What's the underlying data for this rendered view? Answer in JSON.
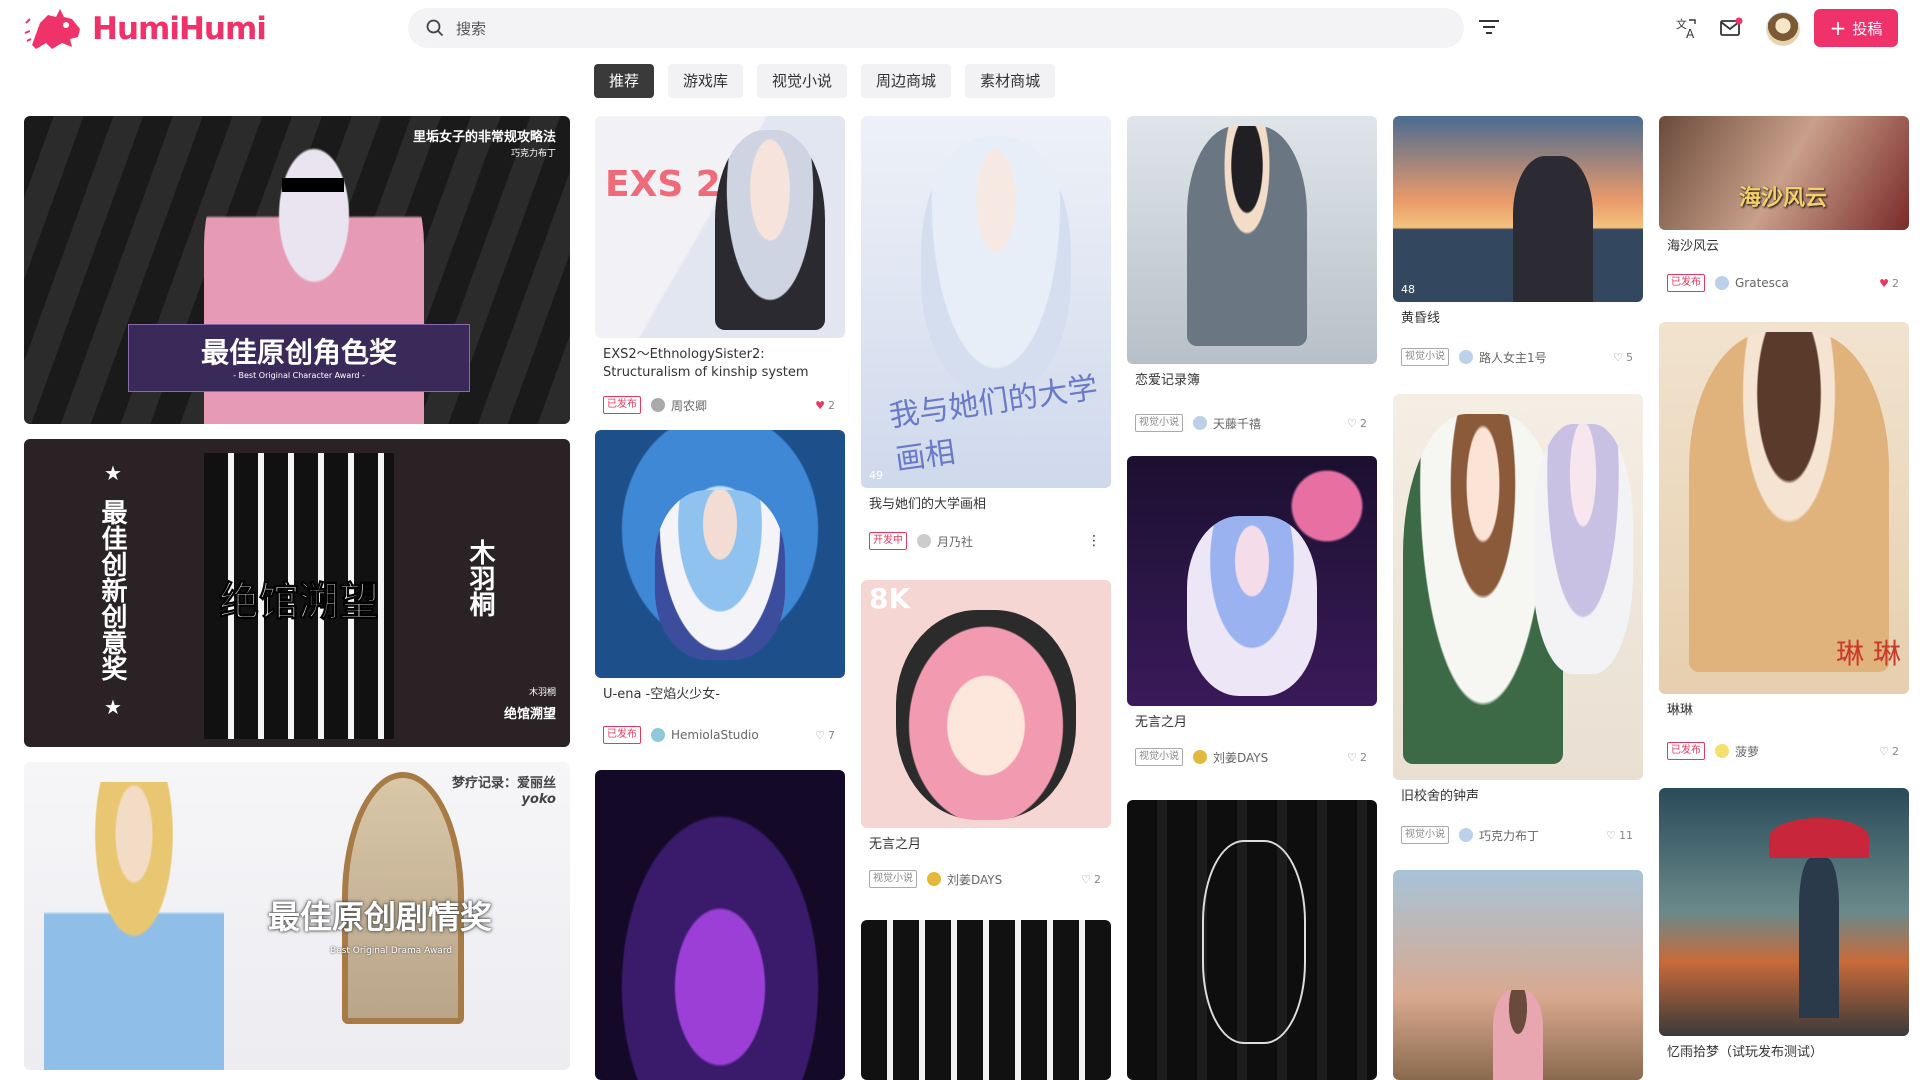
{
  "brand": {
    "name": "HumiHumi",
    "color": "#f0326a"
  },
  "search": {
    "placeholder": "搜索"
  },
  "header": {
    "post_label": "投稿"
  },
  "tabs": [
    "推荐",
    "游戏库",
    "视觉小说",
    "周边商城",
    "素材商城"
  ],
  "banners": [
    {
      "title": "里垢女子的非常规攻略法",
      "author": "巧克力布丁",
      "award_cn": "最佳原创角色奖",
      "award_en": "- Best Original Character Award -"
    },
    {
      "award_cn": "最佳创新创意奖",
      "title": "绝馆溯望",
      "author": "木羽桐",
      "vertical_name": "木羽桐"
    },
    {
      "title": "梦疗记录：爱丽丝",
      "author": "yoko",
      "award_cn": "最佳原创剧情奖",
      "award_en": "Best Original Drama Award"
    }
  ],
  "cards": [
    {
      "title": "EXS2～EthnologySister2:\nStructuralism of kinship system",
      "badge": "已发布",
      "author": "周农卿",
      "likes": "2",
      "liked": true
    },
    {
      "title": "U-ena -空焰火少女-",
      "badge": "已发布",
      "author": "HemiolaStudio",
      "likes": "7"
    },
    {
      "title": "我与她们的大学画相",
      "badge": "开发中",
      "author": "月乃社",
      "views": "49",
      "overlay_text": "我与她们的大学画相"
    },
    {
      "title": "无言之月",
      "badge": "视觉小说",
      "author": "刘姜DAYS",
      "likes": "2",
      "overlay_text": "8K"
    },
    {
      "title": "恋爱记录簿",
      "badge": "视觉小说",
      "author": "天藤千禧",
      "likes": "2"
    },
    {
      "title": "无言之月",
      "badge": "视觉小说",
      "author": "刘姜DAYS",
      "likes": "2"
    },
    {
      "title": "黄昏线",
      "badge": "视觉小说",
      "author": "路人女主1号",
      "likes": "5",
      "views": "48"
    },
    {
      "title": "旧校舍的钟声",
      "badge": "视觉小说",
      "author": "巧克力布丁",
      "likes": "11"
    },
    {
      "title": "海沙风云",
      "badge": "已发布",
      "author": "Gratesca",
      "likes": "2",
      "liked": true,
      "overlay_text": "海沙风云"
    },
    {
      "title": "琳琳",
      "badge": "已发布",
      "author": "菠萝",
      "likes": "2",
      "overlay_text": "琳 琳"
    },
    {
      "title": "忆雨拾梦（试玩发布测试）"
    }
  ]
}
